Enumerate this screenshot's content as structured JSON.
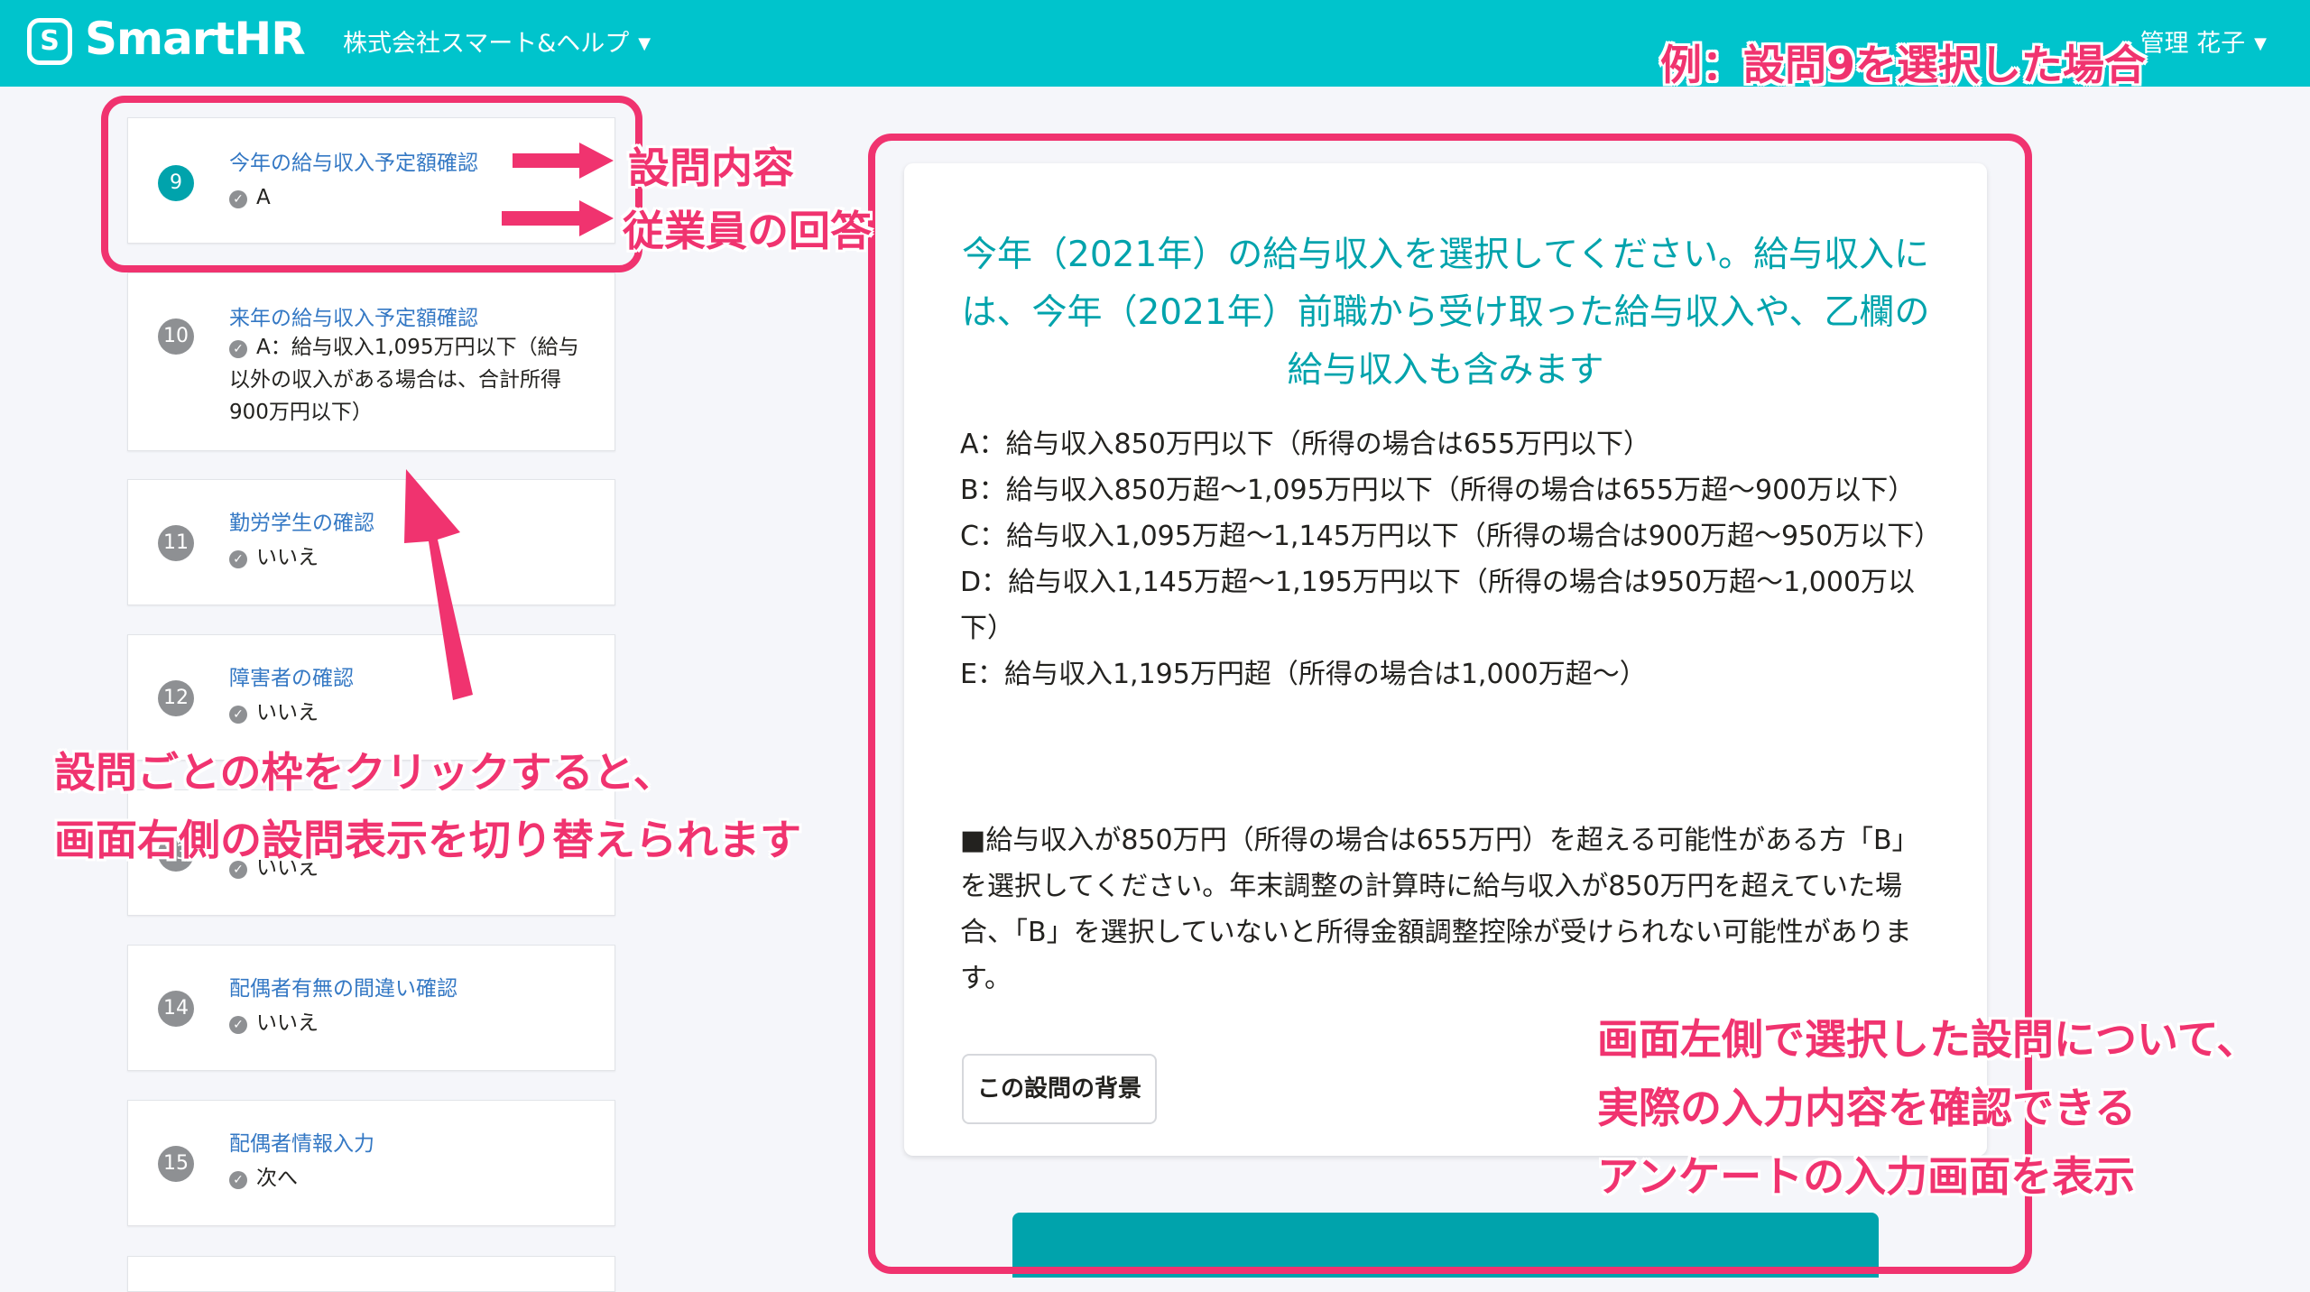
{
  "header": {
    "logo_mark": "S",
    "logo_text": "SmartHR",
    "company": "株式会社スマート&ヘルプ",
    "user": "管理 花子"
  },
  "questions": [
    {
      "num": "9",
      "title": "今年の給与収入予定額確認",
      "answer": "A",
      "active": true
    },
    {
      "num": "10",
      "title": "来年の給与収入予定額確認",
      "answer": "A：給与収入1,095万円以下（給与以外の収入がある場合は、合計所得900万円以下）"
    },
    {
      "num": "11",
      "title": "勤労学生の確認",
      "answer": "いいえ"
    },
    {
      "num": "12",
      "title": "障害者の確認",
      "answer": "いいえ"
    },
    {
      "num": "13",
      "title": "",
      "answer": "いいえ"
    },
    {
      "num": "14",
      "title": "配偶者有無の間違い確認",
      "answer": "いいえ"
    },
    {
      "num": "15",
      "title": "配偶者情報入力",
      "answer": "次へ"
    }
  ],
  "panel": {
    "question": "今年（2021年）の給与収入を選択してください。給与収入には、今年（2021年）前職から受け取った給与収入や、乙欄の給与収入も含みます",
    "options": [
      "A：給与収入850万円以下（所得の場合は655万円以下）",
      "B：給与収入850万超〜1,095万円以下（所得の場合は655万超〜900万以下）",
      "C：給与収入1,095万超〜1,145万円以下（所得の場合は900万超〜950万以下）",
      "D：給与収入1,145万超〜1,195万円以下（所得の場合は950万超〜1,000万以下）",
      "E：給与収入1,195万円超（所得の場合は1,000万超〜）"
    ],
    "note": "■給与収入が850万円（所得の場合は655万円）を超える可能性がある方「B」を選択してください。年末調整の計算時に給与収入が850万円を超えていた場合、「B」を選択していないと所得金額調整控除が受けられない可能性があります。",
    "background_button": "この設問の背景"
  },
  "annotations": {
    "example": "例：設問9を選択した場合",
    "question_content": "設問内容",
    "employee_answer": "従業員の回答",
    "click_line1": "設問ごとの枠をクリックすると、",
    "click_line2": "画面右側の設問表示を切り替えられます",
    "right_line1": "画面左側で選択した設問について、",
    "right_line2": "実際の入力内容を確認できる",
    "right_line3": "アンケートの入力画面を表示"
  },
  "colors": {
    "header": "#00c4cc",
    "accent": "#00a3ac",
    "link": "#3478c4",
    "annotation": "#f0336f"
  }
}
